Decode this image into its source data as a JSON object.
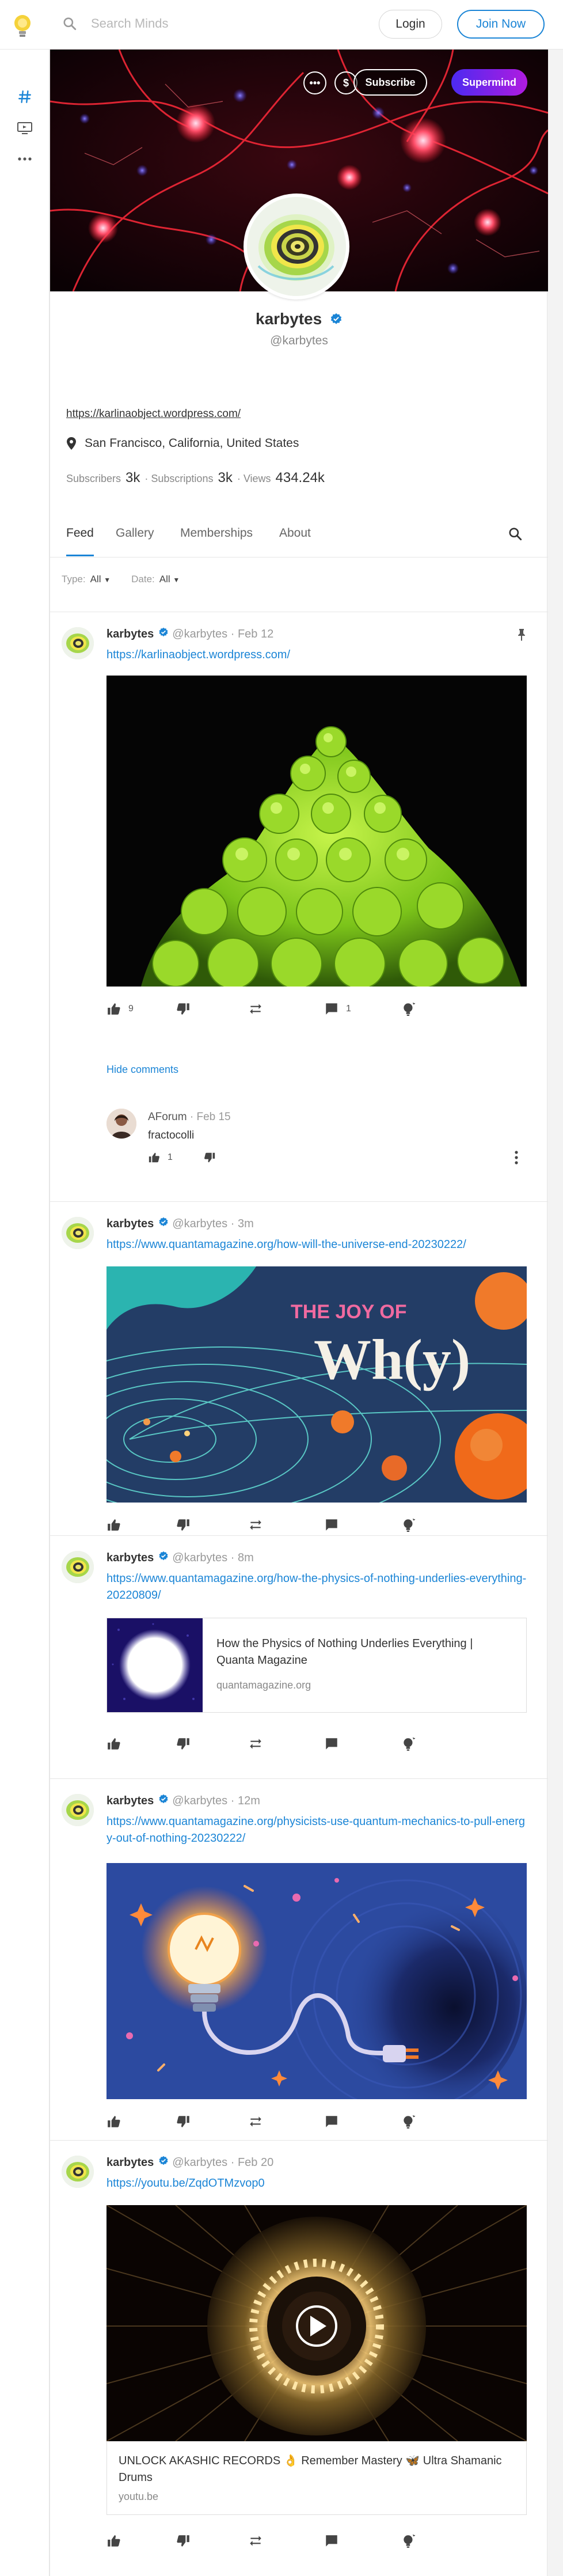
{
  "header": {
    "search_placeholder": "Search Minds",
    "login_label": "Login",
    "join_label": "Join Now"
  },
  "sidebar": {
    "items": [
      {
        "icon": "hashtag-icon"
      },
      {
        "icon": "boost-console-icon"
      },
      {
        "icon": "more-icon"
      }
    ]
  },
  "banner": {
    "more_label": "•••",
    "tip_label": "$",
    "subscribe_label": "Subscribe",
    "supermind_label": "Supermind"
  },
  "profile": {
    "name": "karbytes",
    "handle": "@karbytes",
    "link": "https://karlinaobject.wordpress.com/",
    "location": "San Francisco, California, United States",
    "stats": {
      "subscribers_label": "Subscribers",
      "subscribers_value": "3k",
      "subscriptions_label": "· Subscriptions",
      "subscriptions_value": "3k",
      "views_label": "· Views",
      "views_value": "434.24k"
    }
  },
  "tabs": [
    "Feed",
    "Gallery",
    "Memberships",
    "About"
  ],
  "filters": {
    "type_label": "Type:",
    "type_value": "All",
    "date_label": "Date:",
    "date_value": "All"
  },
  "posts": [
    {
      "author": "karbytes",
      "meta": "@karbytes · Feb 12",
      "link": "https://karlinaobject.wordpress.com/",
      "upvotes": "9",
      "comments": "1",
      "hide_comments": "Hide comments",
      "comment": {
        "author": "AForum",
        "meta": "· Feb 15",
        "text": "fractocolli",
        "upvotes": "1"
      }
    },
    {
      "author": "karbytes",
      "meta": "@karbytes · 3m",
      "link": "https://www.quantamagazine.org/how-will-the-universe-end-20230222/",
      "image_text_1": "THE JOY OF",
      "image_text_2": "Wh(y)"
    },
    {
      "author": "karbytes",
      "meta": "@karbytes · 8m",
      "link": "https://www.quantamagazine.org/how-the-physics-of-nothing-underlies-everything-20220809/",
      "card_title": "How the Physics of Nothing Underlies Everything | Quanta Magazine",
      "card_domain": "quantamagazine.org"
    },
    {
      "author": "karbytes",
      "meta": "@karbytes · 12m",
      "link": "https://www.quantamagazine.org/physicists-use-quantum-mechanics-to-pull-energy-out-of-nothing-20230222/"
    },
    {
      "author": "karbytes",
      "meta": "@karbytes · Feb 20",
      "link": "https://youtu.be/ZqdOTMzvop0",
      "card_title": "UNLOCK AKASHIC RECORDS 👌 Remember Mastery 🦋 Ultra Shamanic Drums",
      "card_domain": "youtu.be"
    }
  ]
}
